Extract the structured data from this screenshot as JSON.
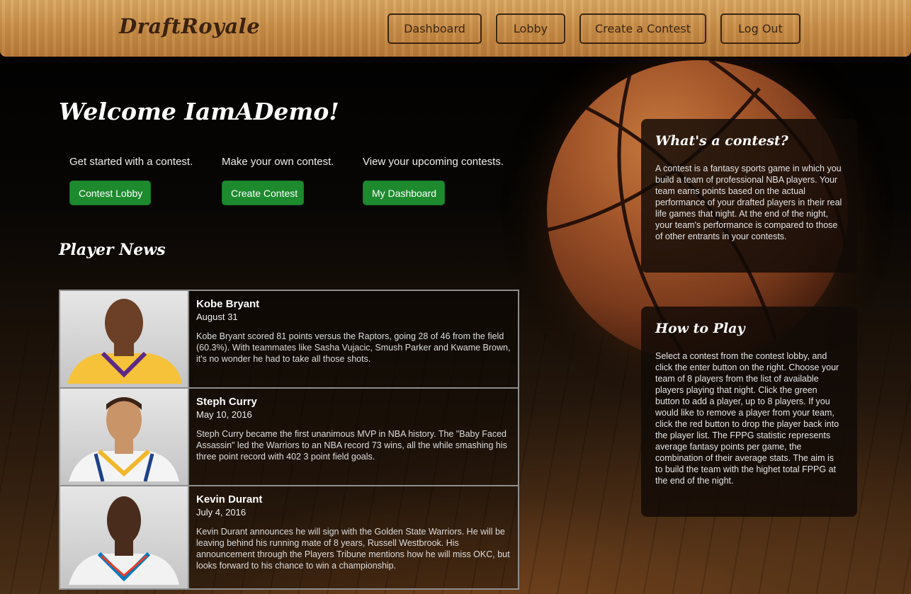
{
  "header": {
    "logo": "DraftRoyale",
    "nav": [
      "Dashboard",
      "Lobby",
      "Create a Contest",
      "Log Out"
    ]
  },
  "welcome": "Welcome IamADemo!",
  "actions": [
    {
      "lead": "Get started with a contest.",
      "button": "Contest Lobby"
    },
    {
      "lead": "Make your own contest.",
      "button": "Create Contest"
    },
    {
      "lead": "View your upcoming contests.",
      "button": "My Dashboard"
    }
  ],
  "news": {
    "title": "Player News",
    "items": [
      {
        "name": "Kobe Bryant",
        "date": "August 31",
        "body": "Kobe Bryant scored 81 points versus the Raptors, going 28 of 46 from the field (60.3%). With teammates like Sasha Vujacic, Smush Parker and Kwame Brown, it's no wonder he had to take all those shots.",
        "jersey_color": "#f5c23a"
      },
      {
        "name": "Steph Curry",
        "date": "May 10, 2016",
        "body": "Steph Curry became the first unanimous MVP in NBA history. The \"Baby Faced Assassin\" led the Warriors to an NBA record 73 wins, all the while smashing his three point record with 402 3 point field goals.",
        "jersey_color": "#f4f4f4"
      },
      {
        "name": "Kevin Durant",
        "date": "July 4, 2016",
        "body": "Kevin Durant announces he will sign with the Golden State Warriors. He will be leaving behind his running mate of 8 years, Russell Westbrook. His announcement through the Players Tribune mentions how he will miss OKC, but looks forward to his chance to win a championship.",
        "jersey_color": "#f2f2f2"
      }
    ]
  },
  "cards": [
    {
      "title": "What's a contest?",
      "body": "A contest is a fantasy sports game in which you build a team of professional NBA players. Your team earns points based on the actual performance of your drafted players in their real life games that night. At the end of the night, your team's performance is compared to those of other entrants in your contests."
    },
    {
      "title": "How to Play",
      "body": "Select a contest from the contest lobby, and click the enter button on the right. Choose your team of 8 players from the list of available players playing that night. Click the green button to add a player, up to 8 players. If you would like to remove a player from your team, click the red button to drop the player back into the player list. The FPPG statistic represents average fantasy points per game, the combination of their average stats. The aim is to build the team with the highet total FPPG at the end of the night."
    }
  ],
  "colors": {
    "button_green": "#1d8a2e",
    "header_wood": "#c98d47",
    "nav_text": "#3b2612"
  }
}
